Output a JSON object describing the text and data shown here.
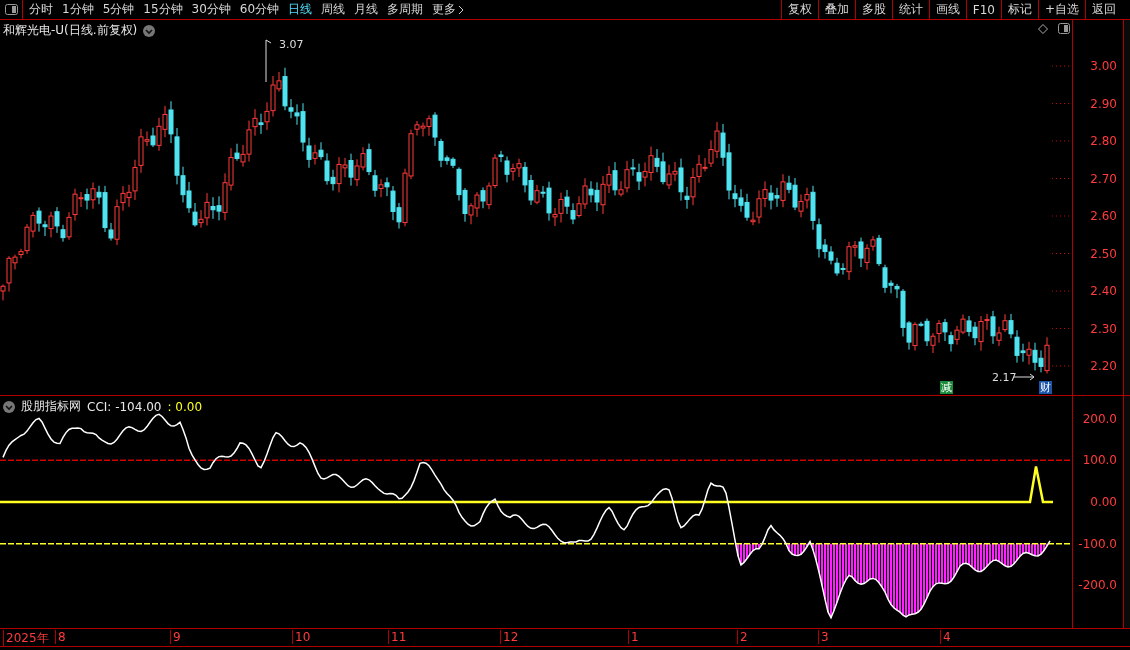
{
  "toolbar": {
    "periods": [
      {
        "label": "分时",
        "selected": false
      },
      {
        "label": "1分钟",
        "selected": false
      },
      {
        "label": "5分钟",
        "selected": false
      },
      {
        "label": "15分钟",
        "selected": false
      },
      {
        "label": "30分钟",
        "selected": false
      },
      {
        "label": "60分钟",
        "selected": false
      },
      {
        "label": "日线",
        "selected": true
      },
      {
        "label": "周线",
        "selected": false
      },
      {
        "label": "月线",
        "selected": false
      },
      {
        "label": "多周期",
        "selected": false
      },
      {
        "label": "更多",
        "selected": false
      }
    ],
    "buttons": [
      "复权",
      "叠加",
      "多股",
      "统计",
      "画线",
      "F10",
      "标记",
      "+自选",
      "返回"
    ]
  },
  "main_chart": {
    "title": "和辉光电-U(日线.前复权)",
    "high_label": "3.07",
    "low_label": "2.17",
    "markers": [
      {
        "label": "减",
        "color": "#1c8c3c"
      },
      {
        "label": "财",
        "color": "#1d56a8"
      }
    ],
    "y_axis": [
      "3.00",
      "2.90",
      "2.80",
      "2.70",
      "2.60",
      "2.50",
      "2.40",
      "2.30",
      "2.20"
    ]
  },
  "indicator": {
    "name": "股朋指标网",
    "reading": "CCI: -104.00",
    "value_2": ": 0.00",
    "y_axis": [
      "200.0",
      "100.0",
      "0.00",
      "-100.0",
      "-200.0"
    ]
  },
  "time_axis": [
    "2025年",
    "8",
    "9",
    "10",
    "11",
    "12",
    "1",
    "2",
    "3",
    "4"
  ]
}
